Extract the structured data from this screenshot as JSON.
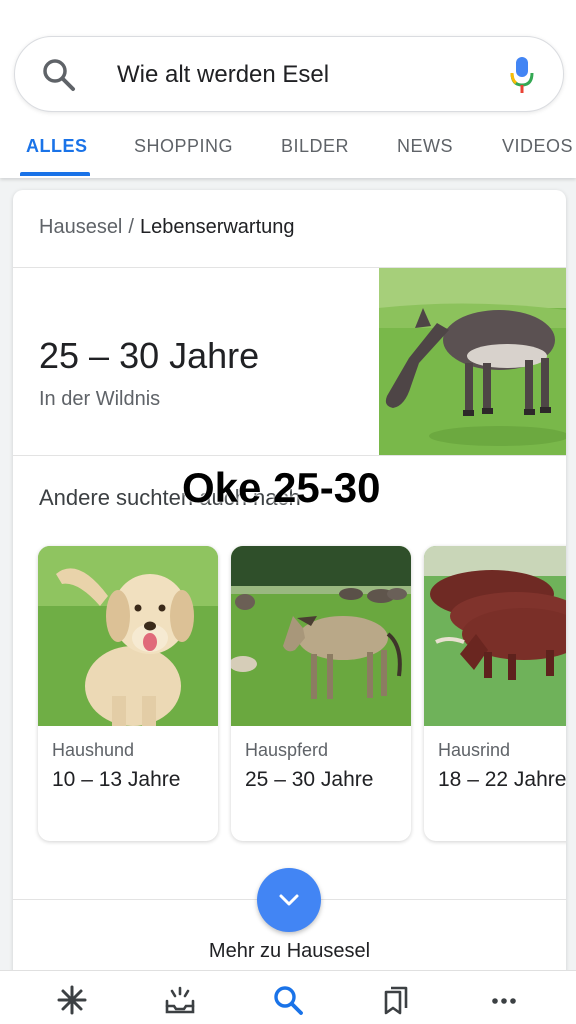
{
  "search": {
    "query": "Wie alt werden Esel",
    "icons": {
      "search": "search-icon",
      "voice": "mic-icon"
    }
  },
  "tabs": [
    {
      "label": "ALLES",
      "active": true
    },
    {
      "label": "SHOPPING",
      "active": false
    },
    {
      "label": "BILDER",
      "active": false
    },
    {
      "label": "NEWS",
      "active": false
    },
    {
      "label": "VIDEOS",
      "active": false
    }
  ],
  "card": {
    "breadcrumb": {
      "parent": "Hausesel",
      "separator": "/",
      "current": "Lebenserwartung"
    },
    "answer": "25 – 30 Jahre",
    "answer_sub": "In der Wildnis",
    "also_searched_title": "Andere suchten auch nach",
    "related": [
      {
        "name": "Haushund",
        "years": "10 – 13 Jahre"
      },
      {
        "name": "Hauspferd",
        "years": "25 – 30 Jahre"
      },
      {
        "name": "Hausrind",
        "years": "18 – 22 Jahre"
      }
    ],
    "more_label": "Mehr zu Hausesel"
  },
  "overlay_caption": "Oke 25-30",
  "bottom_nav": [
    {
      "icon": "discover-icon"
    },
    {
      "icon": "updates-icon"
    },
    {
      "icon": "search-icon",
      "active": true
    },
    {
      "icon": "collections-icon"
    },
    {
      "icon": "more-icon"
    }
  ],
  "colors": {
    "accent": "#1a73e8",
    "more_button": "#4285f4",
    "text_primary": "#202124",
    "text_secondary": "#5f6368"
  }
}
